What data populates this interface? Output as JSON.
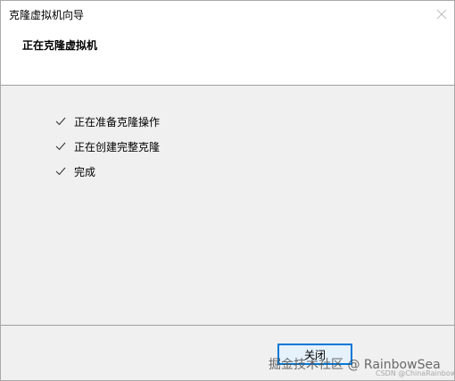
{
  "window": {
    "title": "克隆虚拟机向导",
    "close_icon": "close-icon"
  },
  "header": {
    "title": "正在克隆虚拟机"
  },
  "steps": [
    {
      "label": "正在准备克隆操作",
      "icon": "checkmark-icon",
      "done": true
    },
    {
      "label": "正在创建完整克隆",
      "icon": "checkmark-icon",
      "done": true
    },
    {
      "label": "完成",
      "icon": "checkmark-icon",
      "done": true
    }
  ],
  "footer": {
    "close_label": "关闭"
  },
  "watermark": {
    "text": "掘金技术社区 @ RainbowSea",
    "sub": "CSDN @ChinaRainbowSea"
  },
  "colors": {
    "accent": "#0078d7",
    "title_bg": "#ffffff",
    "body_bg": "#f0f0f0",
    "divider": "#a0a0a0"
  }
}
